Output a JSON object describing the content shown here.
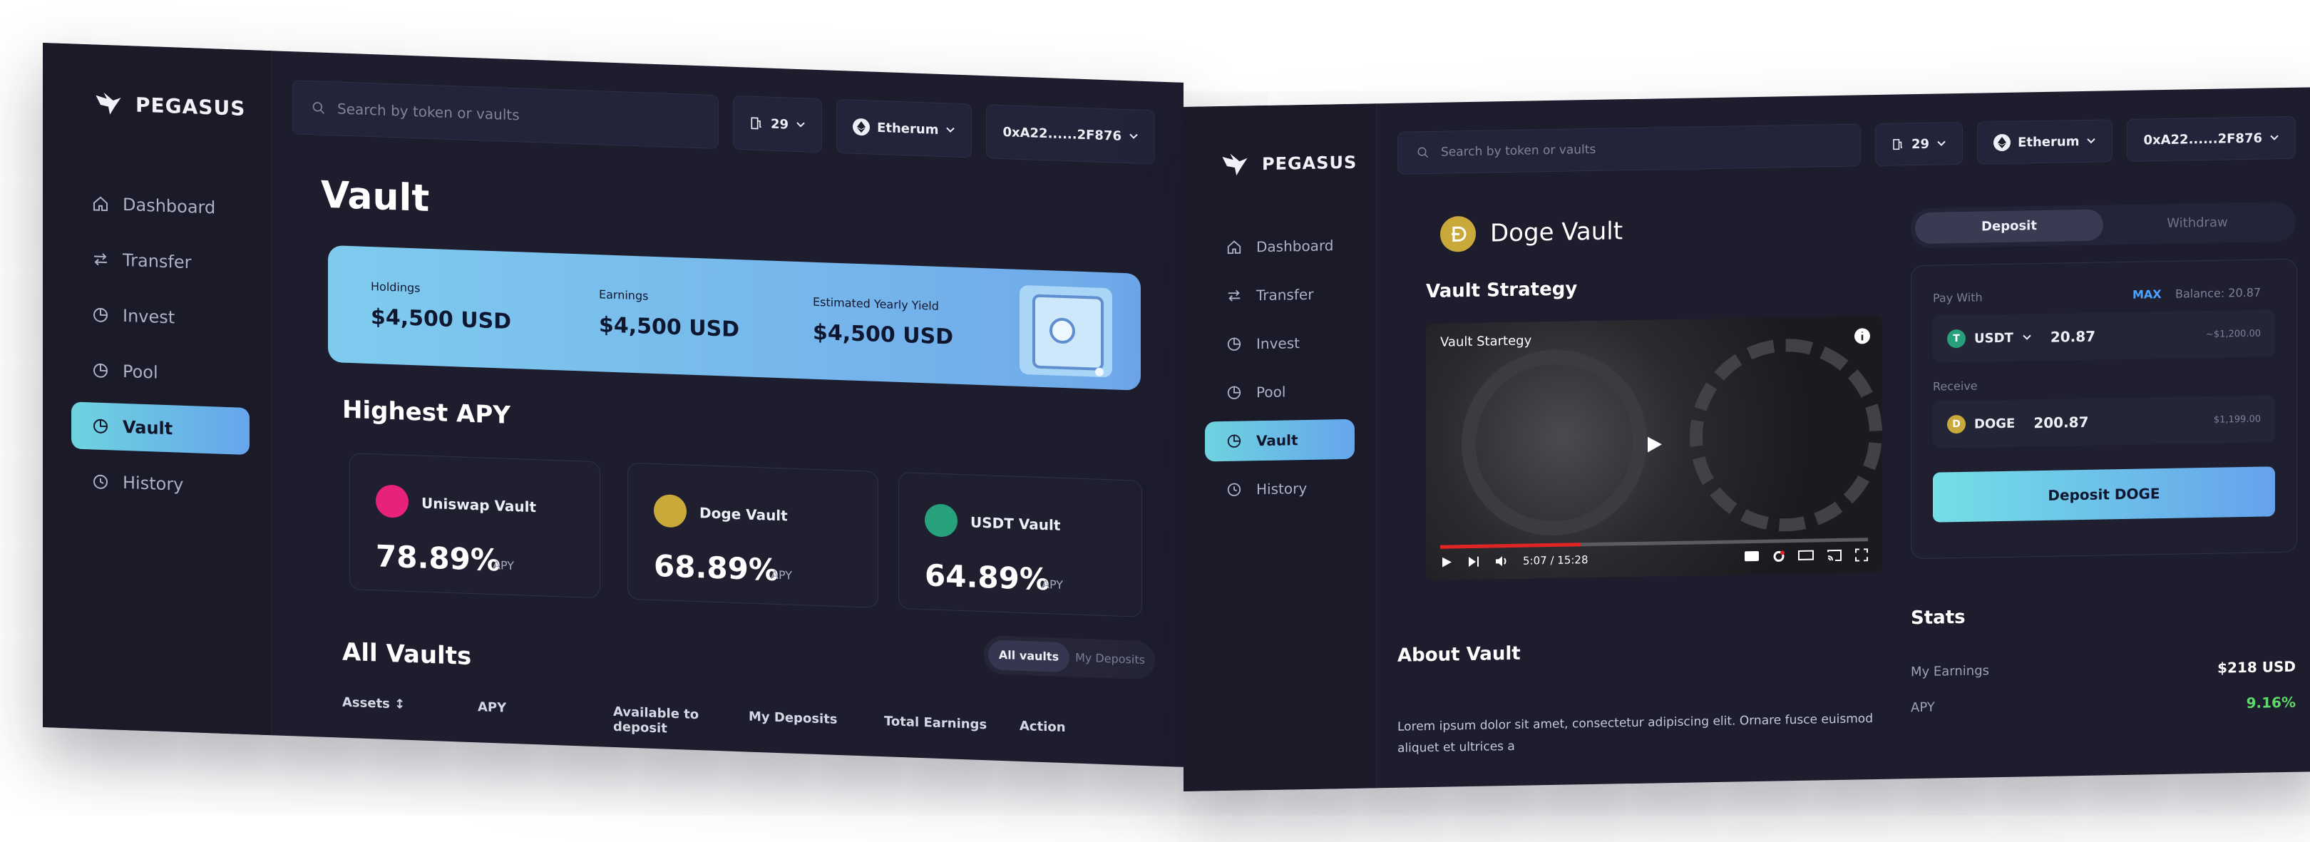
{
  "brand": {
    "name": "PEGASUS"
  },
  "colors": {
    "accent_start": "#6ed3df",
    "accent_end": "#66a5ec",
    "bg": "#1d1d2d"
  },
  "sidebar": {
    "items": [
      {
        "label": "Dashboard",
        "icon": "home-icon"
      },
      {
        "label": "Transfer",
        "icon": "transfer-icon"
      },
      {
        "label": "Invest",
        "icon": "pie-chart-icon"
      },
      {
        "label": "Pool",
        "icon": "pie-chart-icon"
      },
      {
        "label": "Vault",
        "icon": "pie-chart-icon",
        "active": true
      },
      {
        "label": "History",
        "icon": "clock-icon"
      }
    ]
  },
  "topbar": {
    "search_placeholder": "Search by token or vaults",
    "gas": "29",
    "network": "Etherum",
    "wallet": "0xA22......2F876"
  },
  "vault_page": {
    "title": "Vault",
    "holdings_label": "Holdings",
    "holdings_value": "$4,500 USD",
    "earnings_label": "Earnings",
    "earnings_value": "$4,500 USD",
    "yield_label": "Estimated Yearly Yield",
    "yield_value": "$4,500 USD",
    "highest_apy_title": "Highest APY",
    "cards": [
      {
        "name": "Uniswap Vault",
        "apy": "78.89%",
        "unit": "APY",
        "color": "#e8227a"
      },
      {
        "name": "Doge Vault",
        "apy": "68.89%",
        "unit": "APY",
        "color": "#c9a93a"
      },
      {
        "name": "USDT Vault",
        "apy": "64.89%",
        "unit": "APY",
        "color": "#26a17b"
      }
    ],
    "toggle": {
      "all": "All vaults",
      "mine": "My Deposits"
    },
    "all_vaults_title": "All Vaults",
    "columns": [
      "Assets ↕",
      "APY",
      "Available to deposit",
      "My Deposits",
      "Total Earnings",
      "Action"
    ]
  },
  "detail_page": {
    "title": "Doge Vault",
    "strategy_title": "Vault Strategy",
    "video_title": "Vault Startegy",
    "time": "5:07 / 15:28",
    "progress": 0.33,
    "about_title": "About Vault",
    "about_text": "Lorem ipsum dolor sit amet, consectetur adipiscing elit. Ornare fusce euismod aliquet et ultrices a",
    "tabs": {
      "deposit": "Deposit",
      "withdraw": "Withdraw"
    },
    "pay_with_label": "Pay With",
    "max_label": "MAX",
    "balance": "Balance: 20.87",
    "pay_token": "USDT",
    "pay_amount": "20.87",
    "pay_usd": "~$1,200.00",
    "receive_label": "Receive",
    "receive_token": "DOGE",
    "receive_amount": "200.87",
    "receive_usd": "$1,199.00",
    "deposit_button": "Deposit DOGE",
    "stats_title": "Stats",
    "my_earnings_label": "My Earnings",
    "my_earnings_value": "$218 USD",
    "apy_label": "APY",
    "apy_value": "9.16%"
  }
}
